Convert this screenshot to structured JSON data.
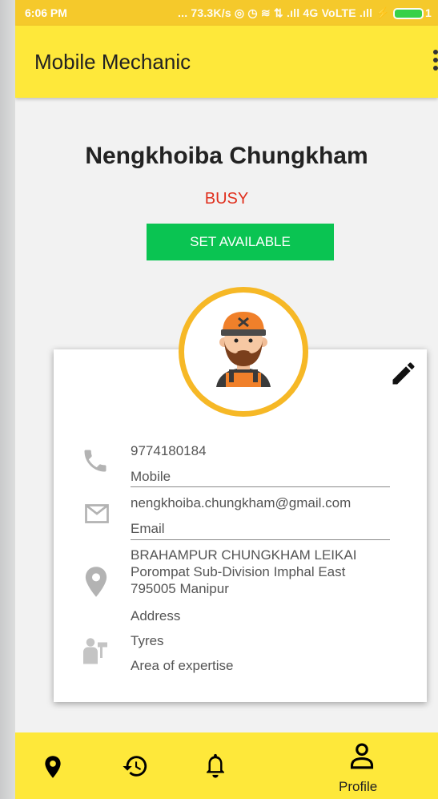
{
  "status_bar": {
    "time": "6:06 PM",
    "right_text": "... 73.3K/s ◎ ◷ ≋ ⇅ .ıll 4G VoLTE .ıll ⚡",
    "battery": "1"
  },
  "app_bar": {
    "title": "Mobile Mechanic",
    "more_icon": "more-vert-icon"
  },
  "profile": {
    "name": "Nengkhoiba Chungkham",
    "status": "BUSY",
    "action_button": "SET AVAILABLE",
    "avatar_icon": "mechanic-avatar",
    "edit_icon": "pencil-icon"
  },
  "details": {
    "phone": {
      "value": "9774180184",
      "label": "Mobile",
      "icon": "phone-icon"
    },
    "email": {
      "value": "nengkhoiba.chungkham@gmail.com",
      "label": "Email",
      "icon": "mail-icon"
    },
    "address": {
      "lines": [
        "BRAHAMPUR CHUNGKHAM LEIKAI",
        "Porompat Sub-Division Imphal East",
        "795005 Manipur"
      ],
      "label": "Address",
      "icon": "location-pin-icon"
    },
    "expertise": {
      "value": "Tyres",
      "label": "Area of expertise",
      "icon": "mechanic-tool-icon"
    }
  },
  "bottom_nav": {
    "items": [
      {
        "icon": "location-pin-icon"
      },
      {
        "icon": "history-icon"
      },
      {
        "icon": "bell-icon"
      },
      {
        "icon": "person-icon",
        "label": "Profile"
      }
    ]
  },
  "colors": {
    "app_bar": "#fee83a",
    "status_bar": "#f5c92b",
    "busy": "#e0301e",
    "available_button": "#0ac452",
    "avatar_ring": "#f6b826"
  }
}
